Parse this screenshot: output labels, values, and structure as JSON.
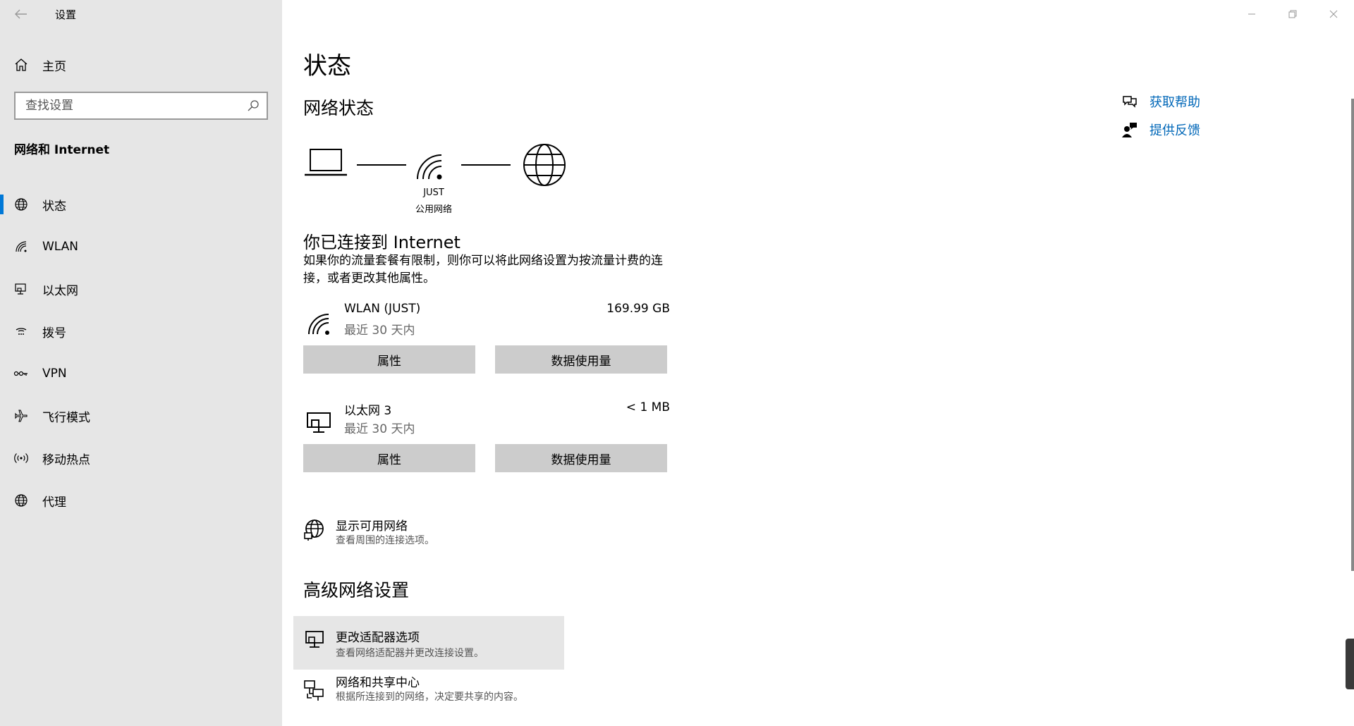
{
  "app": {
    "title": "设置"
  },
  "sidebar": {
    "home_label": "主页",
    "search_placeholder": "查找设置",
    "section_title": "网络和 Internet",
    "items": [
      {
        "label": "状态",
        "icon": "globe-status-icon",
        "active": true
      },
      {
        "label": "WLAN",
        "icon": "wifi-icon",
        "active": false
      },
      {
        "label": "以太网",
        "icon": "ethernet-icon",
        "active": false
      },
      {
        "label": "拨号",
        "icon": "dialup-icon",
        "active": false
      },
      {
        "label": "VPN",
        "icon": "vpn-icon",
        "active": false
      },
      {
        "label": "飞行模式",
        "icon": "airplane-icon",
        "active": false
      },
      {
        "label": "移动热点",
        "icon": "hotspot-icon",
        "active": false
      },
      {
        "label": "代理",
        "icon": "globe-icon",
        "active": false
      }
    ]
  },
  "main": {
    "page_title": "状态",
    "network_status_title": "网络状态",
    "diagram": {
      "network_name": "JUST",
      "network_type": "公用网络"
    },
    "connection_title": "你已连接到 Internet",
    "connection_desc": "如果你的流量套餐有限制，则你可以将此网络设置为按流量计费的连接，或者更改其他属性。",
    "adapters": [
      {
        "name": "WLAN (JUST)",
        "sub": "最近 30 天内",
        "usage": "169.99 GB",
        "btn_properties": "属性",
        "btn_data_usage": "数据使用量",
        "icon": "wifi-icon"
      },
      {
        "name": "以太网 3",
        "sub": "最近 30 天内",
        "usage": "< 1 MB",
        "btn_properties": "属性",
        "btn_data_usage": "数据使用量",
        "icon": "ethernet-icon"
      }
    ],
    "show_networks": {
      "title": "显示可用网络",
      "sub": "查看周围的连接选项。"
    },
    "advanced_title": "高级网络设置",
    "advanced_items": [
      {
        "title": "更改适配器选项",
        "sub": "查看网络适配器并更改连接设置。"
      },
      {
        "title": "网络和共享中心",
        "sub": "根据所连接到的网络，决定要共享的内容。"
      }
    ]
  },
  "help": {
    "get_help": "获取帮助",
    "feedback": "提供反馈"
  },
  "colors": {
    "accent": "#0078d7",
    "link": "#0067b8",
    "sidebar_bg": "#e6e6e6",
    "button_bg": "#cccccc"
  }
}
